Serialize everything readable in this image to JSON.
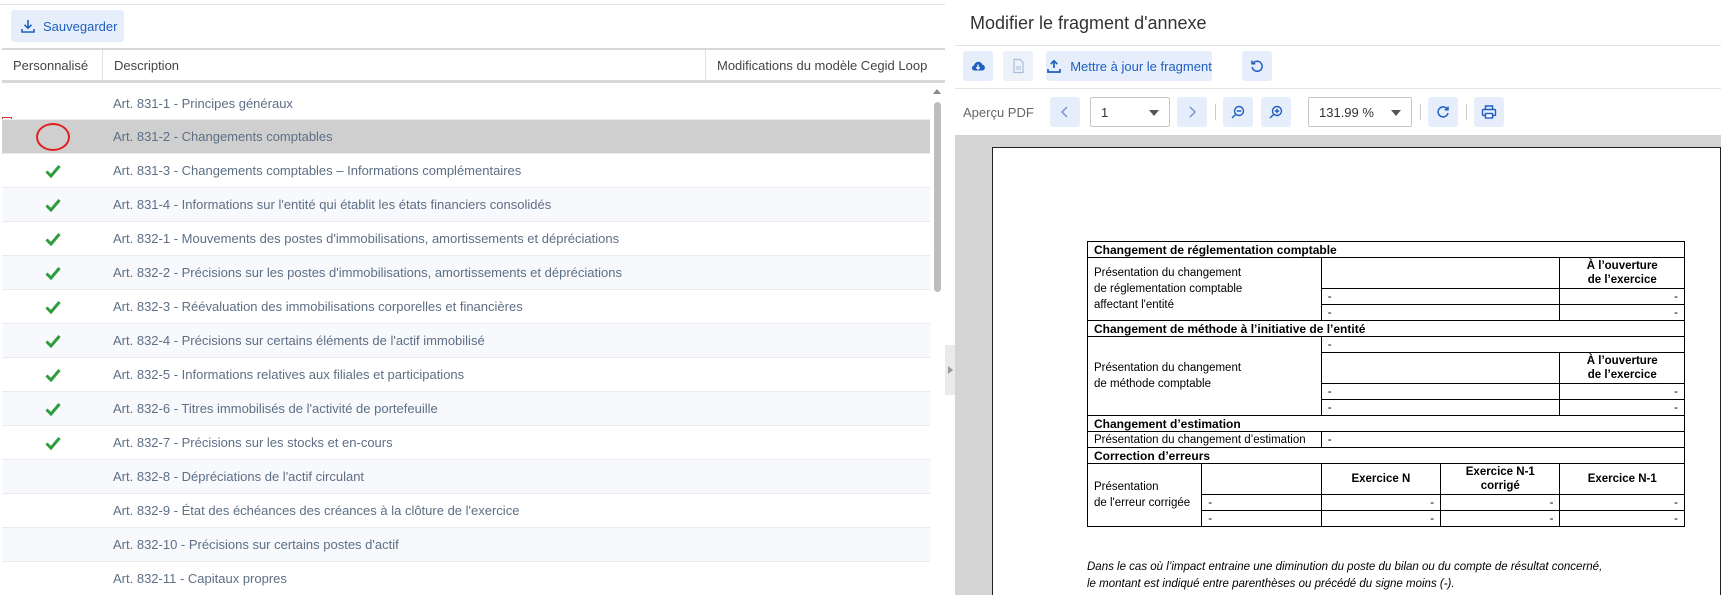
{
  "left": {
    "save_label": "Sauvegarder",
    "columns": {
      "perso": "Personnalisé",
      "desc": "Description",
      "modif": "Modifications du modèle Cegid Loop"
    },
    "rows": [
      {
        "desc": "Art. 831-1 - Principes généraux",
        "mark": "none"
      },
      {
        "desc": "Art. 831-2 - Changements comptables",
        "mark": "circle"
      },
      {
        "desc": "Art. 831-3 - Changements comptables – Informations complémentaires",
        "mark": "check"
      },
      {
        "desc": "Art. 831-4 - Informations sur l'entité qui établit les états financiers consolidés",
        "mark": "check"
      },
      {
        "desc": "Art. 832-1 - Mouvements des postes d'immobilisations, amortissements et dépréciations",
        "mark": "check"
      },
      {
        "desc": "Art. 832-2 - Précisions sur les postes d'immobilisations, amortissements et dépréciations",
        "mark": "check"
      },
      {
        "desc": "Art. 832-3 - Réévaluation des immobilisations corporelles et financières",
        "mark": "check"
      },
      {
        "desc": "Art. 832-4 - Précisions sur certains éléments de l'actif immobilisé",
        "mark": "check"
      },
      {
        "desc": "Art. 832-5 - Informations relatives aux filiales et participations",
        "mark": "check"
      },
      {
        "desc": "Art. 832-6 - Titres immobilisés de l'activité de portefeuille",
        "mark": "check"
      },
      {
        "desc": "Art. 832-7 - Précisions sur les stocks et en-cours",
        "mark": "check"
      },
      {
        "desc": "Art. 832-8 - Dépréciations de l'actif circulant",
        "mark": "none"
      },
      {
        "desc": "Art. 832-9 - État des échéances des créances à la clôture de l'exercice",
        "mark": "none"
      },
      {
        "desc": "Art. 832-10 - Précisions sur certains postes d'actif",
        "mark": "none"
      },
      {
        "desc": "Art. 832-11 - Capitaux propres",
        "mark": "none"
      }
    ]
  },
  "right": {
    "title": "Modifier le fragment d'annexe",
    "update_label": "Mettre à jour le fragment",
    "pdf_label": "Aperçu PDF",
    "page_value": "1",
    "zoom_value": "131.99 %"
  },
  "pdf": {
    "s1_title": "Changement de réglementation comptable",
    "s1_label_1": "Présentation du changement",
    "s1_label_2": "de réglementation comptable",
    "s1_label_3": "affectant l'entité",
    "col_ouverture_1": "À l’ouverture",
    "col_ouverture_2": "de l’exercice",
    "dash": "-",
    "s2_title": "Changement de méthode à l’initiative de l’entité",
    "s2_label_1": "Présentation du changement",
    "s2_label_2": "de méthode comptable",
    "s3_title": "Changement d’estimation",
    "s3_label": "Présentation du changement d’estimation",
    "s4_title": "Correction d’erreurs",
    "s4_label_1": "Présentation",
    "s4_label_2": "de l'erreur corrigée",
    "col_ex_n": "Exercice N",
    "col_ex_n1c_1": "Exercice N-1",
    "col_ex_n1c_2": "corrigé",
    "col_ex_n1": "Exercice N-1",
    "note_1": "Dans le cas où l’impact entraine une diminution du poste du bilan ou du compte de résultat concerné,",
    "note_2": "le montant est indiqué entre parenthèses ou précédé du signe moins (-)."
  }
}
